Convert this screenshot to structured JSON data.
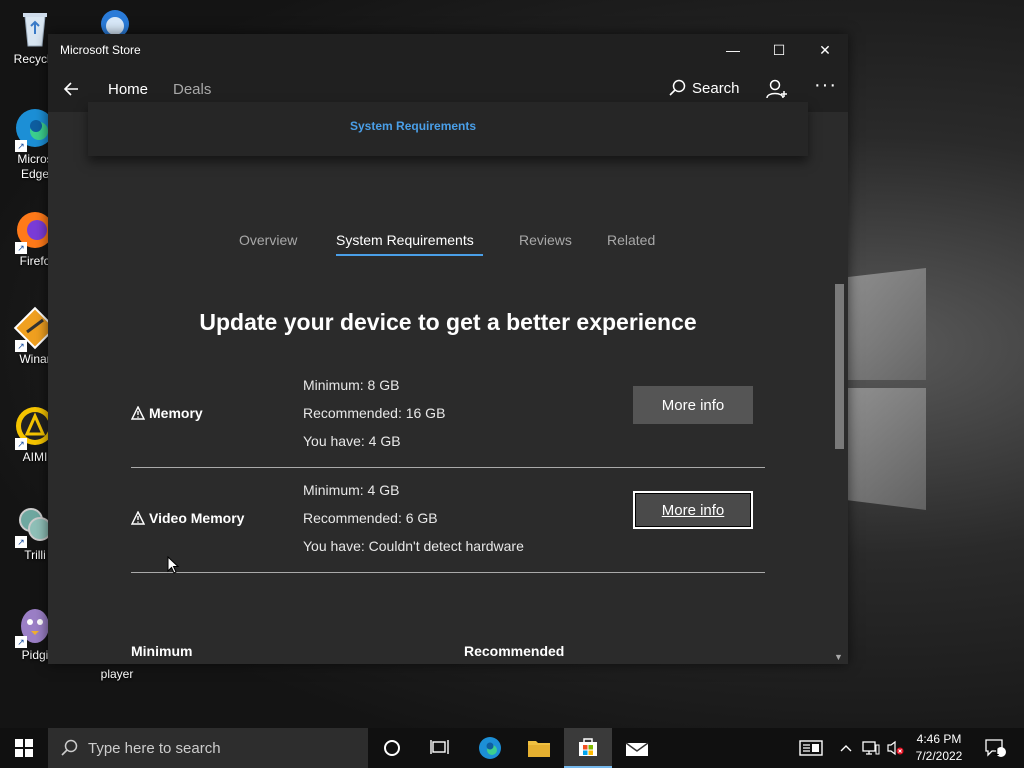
{
  "desktop": {
    "icons": [
      {
        "label": "Recycle"
      },
      {
        "label": "Micros"
      },
      {
        "label": "Edge"
      },
      {
        "label": "Firefo"
      },
      {
        "label": "Winar"
      },
      {
        "label": "AIMI"
      },
      {
        "label": "Trilli"
      },
      {
        "label": "Pidgi"
      },
      {
        "label": "player"
      }
    ]
  },
  "window": {
    "title": "Microsoft Store",
    "minimize": "—",
    "maximize": "☐",
    "close": "✕"
  },
  "nav": {
    "tabs": [
      "Home",
      "Deals"
    ],
    "search_label": "Search",
    "more_label": "···"
  },
  "card": {
    "link": "System Requirements"
  },
  "subtabs": [
    "Overview",
    "System Requirements",
    "Reviews",
    "Related"
  ],
  "headline": "Update your device to get a better experience",
  "requirements": [
    {
      "name": "Memory",
      "minimum": "Minimum: 8 GB",
      "recommended": "Recommended: 16 GB",
      "you_have": "You have: 4 GB",
      "button": "More info"
    },
    {
      "name": "Video Memory",
      "minimum": "Minimum: 4 GB",
      "recommended": "Recommended: 6 GB",
      "you_have": "You have: Couldn't detect hardware",
      "button": "More info"
    }
  ],
  "columns": {
    "minimum": "Minimum",
    "recommended": "Recommended"
  },
  "taskbar": {
    "search_placeholder": "Type here to search",
    "time": "4:46 PM",
    "date": "7/2/2022",
    "notifications": "1"
  },
  "colors": {
    "accent": "#4a9fe8",
    "window_bg": "#2b2b2b",
    "titlebar_bg": "#202020"
  }
}
